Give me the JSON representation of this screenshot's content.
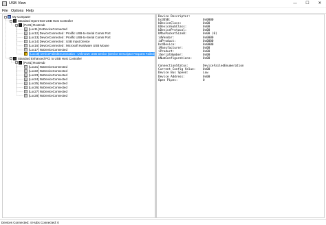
{
  "window": {
    "title": "USB View",
    "minimize_glyph": "—",
    "maximize_glyph": "☐",
    "close_glyph": "✕"
  },
  "menu": [
    "File",
    "Options",
    "Help"
  ],
  "tree": [
    {
      "depth": 0,
      "icon": "computer-icon",
      "expander": "−",
      "label": "My Computer",
      "selected": false
    },
    {
      "depth": 1,
      "icon": "controller-icon",
      "expander": "−",
      "label": "Standard OpenHCD USB Host Controller",
      "selected": false
    },
    {
      "depth": 2,
      "icon": "hub-icon",
      "expander": "−",
      "label": "[Port1] RootHub",
      "selected": false
    },
    {
      "depth": 3,
      "icon": "port-icon",
      "expander": "",
      "label": "[Loc11] NoDeviceConnected",
      "selected": false
    },
    {
      "depth": 3,
      "icon": "port-icon",
      "expander": "",
      "label": "[Loc12] DeviceConnected  :  Prolific USB-to-Serial Comm Port",
      "selected": false
    },
    {
      "depth": 3,
      "icon": "port-icon",
      "expander": "",
      "label": "[Loc13] DeviceConnected  :  Prolific USB-to-Serial Comm Port",
      "selected": false
    },
    {
      "depth": 3,
      "icon": "port-icon",
      "expander": "",
      "label": "[Loc14] DeviceConnected  :  USB Input Device",
      "selected": false
    },
    {
      "depth": 3,
      "icon": "port-icon",
      "expander": "",
      "label": "[Loc16] DeviceConnected  :  Microsoft Hardware USB Mouse",
      "selected": false
    },
    {
      "depth": 3,
      "icon": "port-icon",
      "expander": "",
      "label": "[Loc17] NoDeviceConnected",
      "selected": false
    },
    {
      "depth": 3,
      "icon": "warning-icon",
      "expander": "",
      "label": "[Loc18] DeviceFailedEnumeration  :  Unknown USB Device (Device Descriptor Request Failed)",
      "selected": true
    },
    {
      "depth": 1,
      "icon": "controller-icon",
      "expander": "−",
      "label": "Standard Enhanced PCI to USB Host Controller",
      "selected": false
    },
    {
      "depth": 2,
      "icon": "hub-icon",
      "expander": "−",
      "label": "[Port1] RootHub",
      "selected": false
    },
    {
      "depth": 3,
      "icon": "port-icon",
      "expander": "",
      "label": "[Loc21] NoDeviceConnected",
      "selected": false
    },
    {
      "depth": 3,
      "icon": "port-icon",
      "expander": "",
      "label": "[Loc22] NoDeviceConnected",
      "selected": false
    },
    {
      "depth": 3,
      "icon": "port-icon",
      "expander": "",
      "label": "[Loc23] NoDeviceConnected",
      "selected": false
    },
    {
      "depth": 3,
      "icon": "port-icon",
      "expander": "",
      "label": "[Loc24] NoDeviceConnected",
      "selected": false
    },
    {
      "depth": 3,
      "icon": "port-icon",
      "expander": "",
      "label": "[Loc25] NoDeviceConnected",
      "selected": false
    },
    {
      "depth": 3,
      "icon": "port-icon",
      "expander": "",
      "label": "[Loc26] NoDeviceConnected",
      "selected": false
    },
    {
      "depth": 3,
      "icon": "port-icon",
      "expander": "",
      "label": "[Loc27] NoDeviceConnected",
      "selected": false
    },
    {
      "depth": 3,
      "icon": "port-icon",
      "expander": "",
      "label": "[Loc28] NoDeviceConnected",
      "selected": false
    }
  ],
  "details": {
    "descriptor_header": "Device Descriptor:",
    "descriptor": [
      {
        "label": "bcdUSB:",
        "value": "0x0000"
      },
      {
        "label": "bDeviceClass:",
        "value": "0x00"
      },
      {
        "label": "bDeviceSubClass:",
        "value": "0x00"
      },
      {
        "label": "bDeviceProtocol:",
        "value": "0x00"
      },
      {
        "label": "bMaxPacketSize0:",
        "value": "0x00 (0)"
      },
      {
        "label": "idVendor:",
        "value": "0x0000"
      },
      {
        "label": "idProduct:",
        "value": "0x0000"
      },
      {
        "label": "bcdDevice:",
        "value": "0x0000"
      },
      {
        "label": "iManufacturer:",
        "value": "0x00"
      },
      {
        "label": "iProduct:",
        "value": "0x00"
      },
      {
        "label": "iSerialNumber:",
        "value": "0x00"
      },
      {
        "label": "bNumConfigurations:",
        "value": "0x00"
      }
    ],
    "status": [
      {
        "label": "ConnectionStatus:",
        "value": "DeviceFailedEnumeration"
      },
      {
        "label": "Current Config Value:",
        "value": "0x00"
      },
      {
        "label": "Device Bus Speed:",
        "value": "Low"
      },
      {
        "label": "Device Address:",
        "value": "0x00"
      },
      {
        "label": "Open Pipes:",
        "value": "0"
      }
    ]
  },
  "statusbar": {
    "text": "Devices Connected: 4    Hubs Connected: 0"
  },
  "colors": {
    "selection": "#3399ff",
    "warning": "#f2c200"
  }
}
